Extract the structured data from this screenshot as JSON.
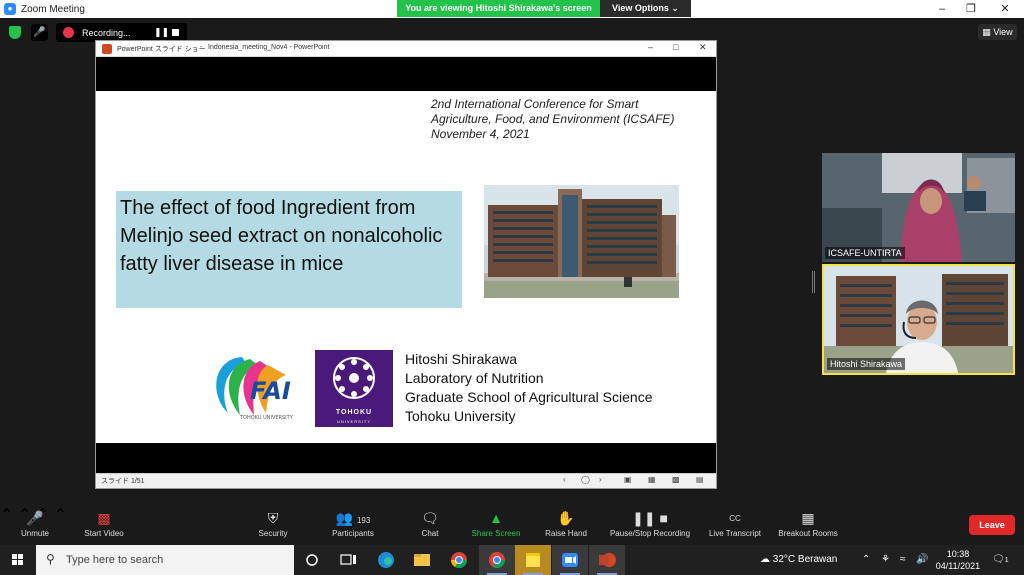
{
  "zoom": {
    "app_title": "Zoom Meeting",
    "share_banner": "You are viewing Hitoshi Shirakawa's screen",
    "view_options": "View Options ⌄",
    "recording_label": "Recording...",
    "view_button": "View",
    "window_controls": [
      "–",
      "❐",
      "✕"
    ]
  },
  "ppt": {
    "title_app": "PowerPoint スライド ショー",
    "title_sep": "-",
    "title_file": "Indonesia_meeting_Nov4 - PowerPoint",
    "controls": [
      "–",
      "□",
      "✕"
    ],
    "status_counter": "スライド 1/51",
    "nav": [
      "‹",
      "◯",
      "›"
    ]
  },
  "slide": {
    "conference_lines": [
      "2nd International Conference for Smart",
      "Agriculture, Food, and Environment (ICSAFE)",
      "November 4, 2021"
    ],
    "title": "The effect of food Ingredient from Melinjo seed extract on nonalcoholic fatty liver disease in mice",
    "author_lines": [
      "Hitoshi Shirakawa",
      "Laboratory of Nutrition",
      "Graduate School of Agricultural Science",
      "Tohoku University"
    ],
    "fai_logo_text": "FAI",
    "fai_logo_sub": "TOHOKU UNIVERSITY",
    "tohoku_logo_text": "TOHOKU",
    "tohoku_logo_sub": "UNIVERSITY"
  },
  "participants": [
    {
      "name": "ICSAFE-UNTIRTA"
    },
    {
      "name": "Hitoshi Shirakawa"
    }
  ],
  "toolbar": {
    "unmute": "Unmute",
    "start_video": "Start Video",
    "security": "Security",
    "participants": "Participants",
    "participant_count": "193",
    "chat": "Chat",
    "share_screen": "Share Screen",
    "raise_hand": "Raise Hand",
    "pause_stop": "Pause/Stop Recording",
    "live_transcript": "Live Transcript",
    "live_transcript_icon": "CC",
    "breakout": "Breakout Rooms",
    "leave": "Leave"
  },
  "taskbar": {
    "search_placeholder": "Type here to search",
    "weather": "32°C  Berawan",
    "time": "10:38",
    "date": "04/11/2021",
    "notifications": "1"
  },
  "colors": {
    "zoom_green": "#23c24a",
    "leave_red": "#e02828",
    "active_speaker": "#f2e543",
    "slide_title_bg": "#b4dbe3",
    "tohoku_purple": "#4a1a7a"
  }
}
